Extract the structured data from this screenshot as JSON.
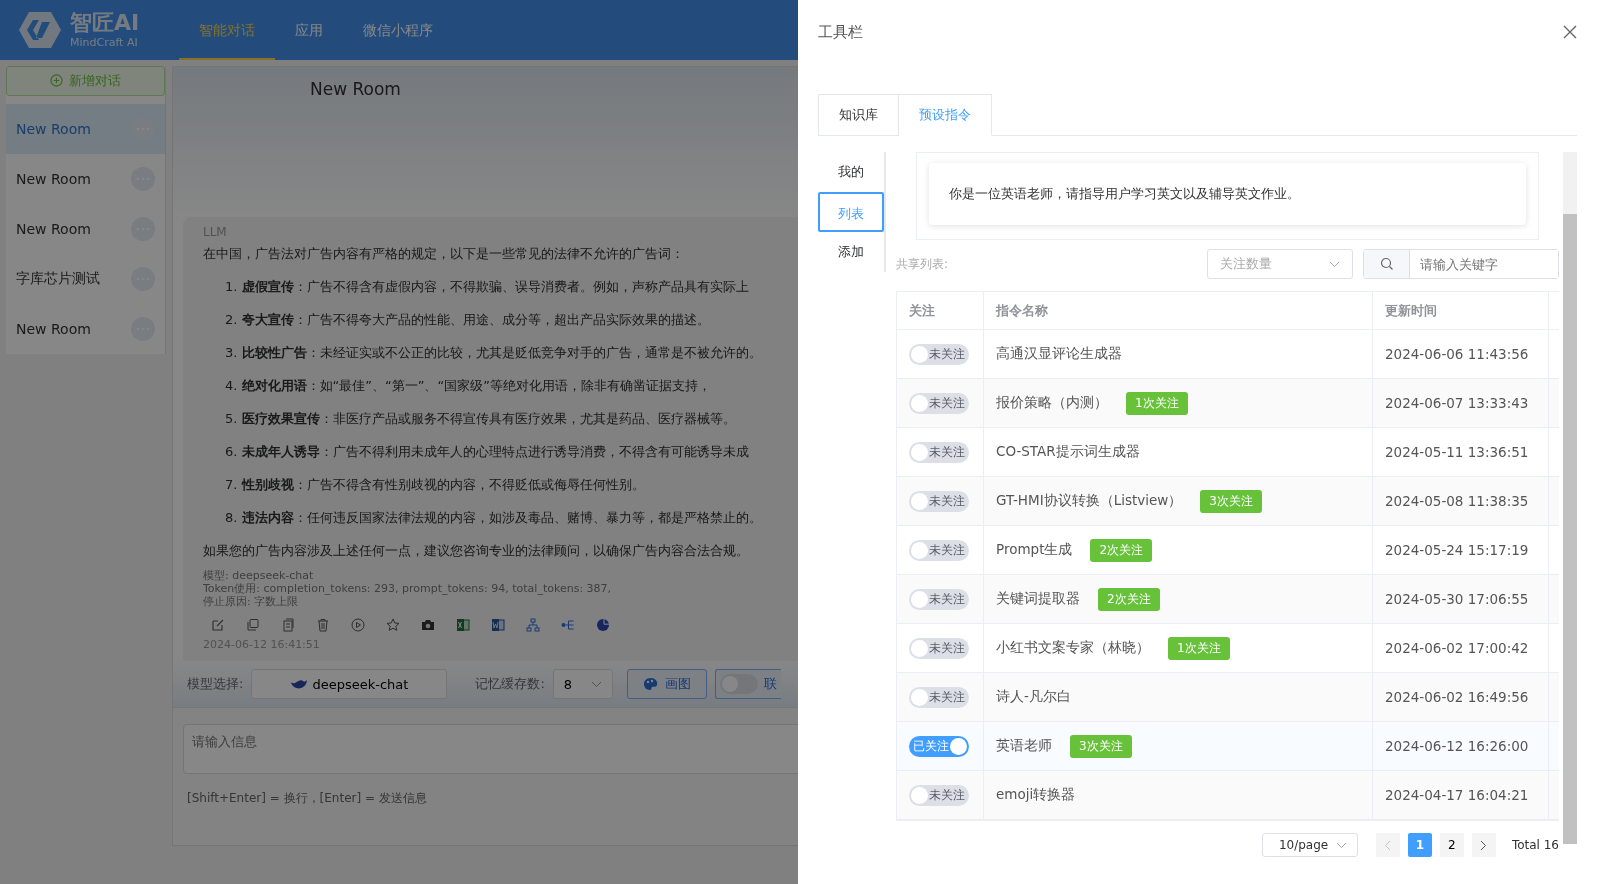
{
  "header": {
    "logo_title": "智匠AI",
    "logo_subtitle": "MindCraft AI",
    "nav": [
      {
        "label": "智能对话",
        "selected": true
      },
      {
        "label": "应用",
        "selected": false
      },
      {
        "label": "微信小程序",
        "selected": false
      }
    ]
  },
  "sidebar": {
    "new_button": "新增对话",
    "items": [
      {
        "label": "New Room",
        "selected": true
      },
      {
        "label": "New Room",
        "selected": false
      },
      {
        "label": "New Room",
        "selected": false
      },
      {
        "label": "字库芯片测试",
        "selected": false
      },
      {
        "label": "New Room",
        "selected": false
      }
    ]
  },
  "chat": {
    "title": "New Room",
    "message": {
      "sender": "LLM",
      "intro": "在中国，广告法对广告内容有严格的规定，以下是一些常见的法律不允许的广告词：",
      "items": [
        "1. **虚假宣传**：广告不得含有虚假内容，不得欺骗、误导消费者。例如，声称产品具有实际上",
        "2. **夸大宣传**：广告不得夸大产品的性能、用途、成分等，超出产品实际效果的描述。",
        "3. **比较性广告**：未经证实或不公正的比较，尤其是贬低竞争对手的广告，通常是不被允许的。",
        "4. **绝对化用语**：如“最佳”、“第一”、“国家级”等绝对化用语，除非有确凿证据支持，",
        "5. **医疗效果宣传**：非医疗产品或服务不得宣传具有医疗效果，尤其是药品、医疗器械等。",
        "6. **未成年人诱导**：广告不得利用未成年人的心理特点进行诱导消费，不得含有可能诱导未成",
        "7. **性别歧视**：广告不得含有性别歧视的内容，不得贬低或侮辱任何性别。",
        "8. **违法内容**：任何违反国家法律法规的内容，如涉及毒品、赌博、暴力等，都是严格禁止的。"
      ],
      "conclusion": "如果您的广告内容涉及上述任何一点，建议您咨询专业的法律顾问，以确保广告内容合法合规。",
      "meta": [
        "模型: deepseek-chat",
        "Token使用: completion_tokens: 293, prompt_tokens: 94, total_tokens: 387,",
        "停止原因: 字数上限"
      ],
      "time": "2024-06-12 16:41:51"
    },
    "toolbar": {
      "model_label": "模型选择:",
      "model": "deepseek-chat",
      "memory_label": "记忆缓存数:",
      "memory": "8",
      "draw_button": "画图",
      "web_switch": {
        "on": false,
        "label": "联"
      }
    },
    "input": {
      "placeholder": "请输入信息"
    },
    "hint": "[Shift+Enter] = 换行，[Enter] = 发送信息"
  },
  "drawer": {
    "title": "工具栏",
    "tabs": [
      {
        "label": "知识库",
        "selected": false
      },
      {
        "label": "预设指令",
        "selected": true
      }
    ],
    "menu": [
      {
        "label": "我的",
        "selected": false
      },
      {
        "label": "列表",
        "selected": true
      },
      {
        "label": "添加",
        "selected": false
      }
    ],
    "prompt_text": "你是一位英语老师，请指导用户学习英文以及辅导英文作业。",
    "shared_label": "共享列表:",
    "sort_select": {
      "placeholder": "关注数量"
    },
    "search": {
      "placeholder": "请输入关键字"
    },
    "table": {
      "columns": [
        "关注",
        "指令名称",
        "更新时间"
      ],
      "rows": [
        {
          "followed": false,
          "switch_label": "未关注",
          "name": "高通汉显评论生成器",
          "time": "2024-06-06 11:43:56"
        },
        {
          "followed": false,
          "switch_label": "未关注",
          "name": "报价策略（内测）",
          "badge": "1次关注",
          "time": "2024-06-07 13:33:43"
        },
        {
          "followed": false,
          "switch_label": "未关注",
          "name": "CO-STAR提示词生成器",
          "time": "2024-05-11 13:36:51"
        },
        {
          "followed": false,
          "switch_label": "未关注",
          "name": "GT-HMI协议转换（Listview）",
          "badge": "3次关注",
          "time": "2024-05-08 11:38:35"
        },
        {
          "followed": false,
          "switch_label": "未关注",
          "name": "Prompt生成",
          "badge": "2次关注",
          "time": "2024-05-24 15:17:19"
        },
        {
          "followed": false,
          "switch_label": "未关注",
          "name": "关键词提取器",
          "badge": "2次关注",
          "time": "2024-05-30 17:06:55"
        },
        {
          "followed": false,
          "switch_label": "未关注",
          "name": "小红书文案专家（林晓）",
          "badge": "1次关注",
          "time": "2024-06-02 17:00:42"
        },
        {
          "followed": false,
          "switch_label": "未关注",
          "name": "诗人-凡尔白",
          "time": "2024-06-02 16:49:56"
        },
        {
          "followed": true,
          "switch_label": "已关注",
          "name": "英语老师",
          "badge": "3次关注",
          "time": "2024-06-12 16:26:00"
        },
        {
          "followed": false,
          "switch_label": "未关注",
          "name": "emoji转换器",
          "time": "2024-04-17 16:04:21"
        }
      ]
    },
    "pagination": {
      "page_size": "10/page",
      "pages": [
        {
          "label": "1",
          "selected": true
        },
        {
          "label": "2",
          "selected": false
        }
      ],
      "total": "Total 16"
    }
  }
}
